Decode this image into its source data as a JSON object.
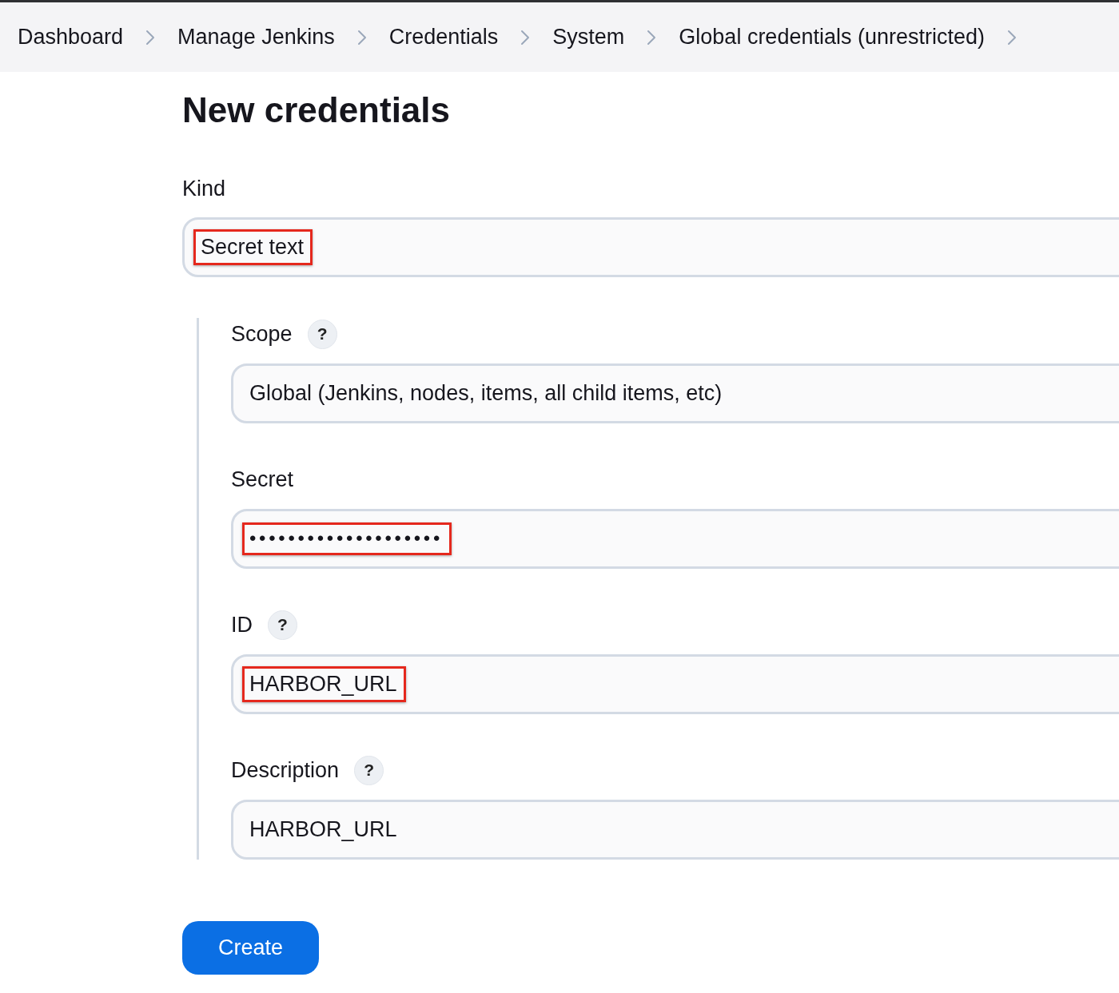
{
  "breadcrumbs": [
    {
      "label": "Dashboard"
    },
    {
      "label": "Manage Jenkins"
    },
    {
      "label": "Credentials"
    },
    {
      "label": "System"
    },
    {
      "label": "Global credentials (unrestricted)"
    }
  ],
  "title": "New credentials",
  "kind_field": {
    "label": "Kind",
    "kind": "select",
    "value": "Secret text",
    "highlighted": true
  },
  "credential_fields": [
    {
      "label": "Scope",
      "help": "?",
      "kind": "select",
      "value": "Global (Jenkins, nodes, items, all child items, etc)",
      "highlighted": false
    },
    {
      "label": "Secret",
      "kind": "password",
      "value": "••••••••••••••••••••",
      "highlighted": true
    },
    {
      "label": "ID",
      "help": "?",
      "kind": "text",
      "value": "HARBOR_URL",
      "highlighted": true
    },
    {
      "label": "Description",
      "help": "?",
      "kind": "text",
      "value": "HARBOR_URL",
      "highlighted": false
    }
  ],
  "create_button": "Create"
}
